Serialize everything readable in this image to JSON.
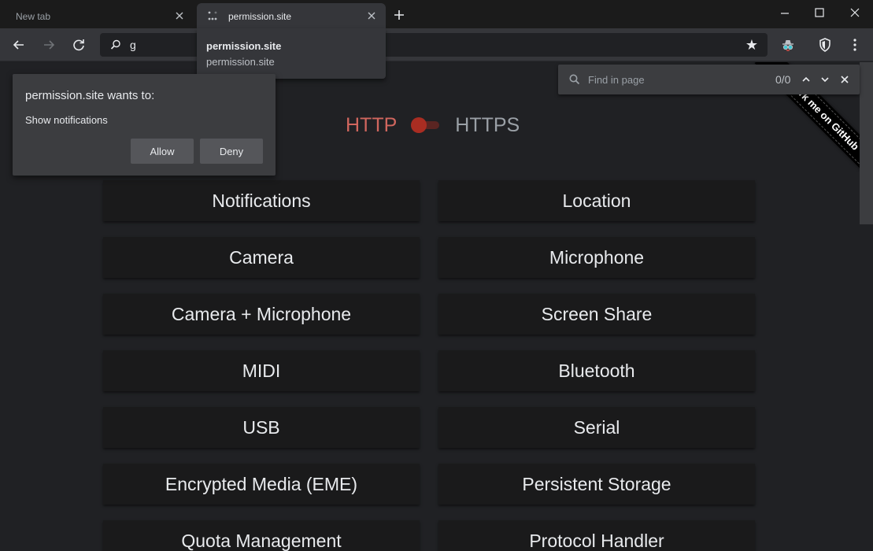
{
  "tabs": [
    {
      "title": "New tab",
      "active": false
    },
    {
      "title": "permission.site",
      "active": true
    }
  ],
  "omnibox": {
    "text": "g"
  },
  "suggestion": {
    "title": "permission.site",
    "url": "permission.site"
  },
  "find_bar": {
    "placeholder": "Find in page",
    "count": "0/0"
  },
  "prompt": {
    "title": "permission.site wants to:",
    "item": "Show notifications",
    "allow_label": "Allow",
    "deny_label": "Deny"
  },
  "protocol_toggle": {
    "left_label": "HTTP",
    "right_label": "HTTPS",
    "http_color": "#d0665e",
    "knob_color": "#a92d22"
  },
  "ribbon": {
    "text": "Fork me on GitHub"
  },
  "permissions": [
    "Notifications",
    "Location",
    "Camera",
    "Microphone",
    "Camera + Microphone",
    "Screen Share",
    "MIDI",
    "Bluetooth",
    "USB",
    "Serial",
    "Encrypted Media (EME)",
    "Persistent Storage",
    "Quota Management",
    "Protocol Handler"
  ],
  "icons": {
    "back": "arrow-left-icon",
    "forward": "arrow-right-icon",
    "reload": "reload-icon",
    "bookmark": "star-icon",
    "extension": "incognito-extension-icon",
    "shield": "shield-icon",
    "menu": "kebab-menu-icon"
  }
}
